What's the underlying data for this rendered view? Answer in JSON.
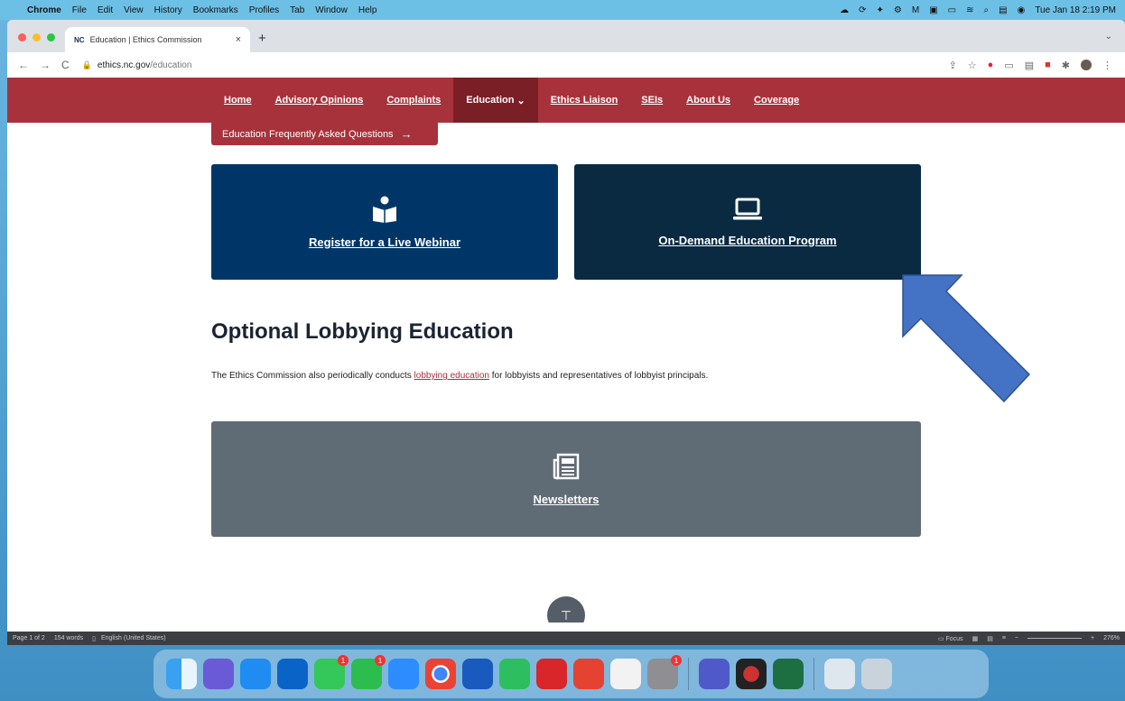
{
  "menubar": {
    "app": "Chrome",
    "items": [
      "File",
      "Edit",
      "View",
      "History",
      "Bookmarks",
      "Profiles",
      "Tab",
      "Window",
      "Help"
    ],
    "clock": "Tue Jan 18  2:19 PM"
  },
  "browser": {
    "tab_favicon": "NC",
    "tab_title": "Education | Ethics Commission",
    "url_host": "ethics.nc.gov",
    "url_path": "/education"
  },
  "site": {
    "nav": [
      "Home",
      "Advisory Opinions",
      "Complaints"
    ],
    "nav_active": "Education",
    "nav_after": [
      "Ethics Liaison",
      "SEIs",
      "About Us",
      "Coverage"
    ],
    "faq_button": "Education Frequently Asked Questions",
    "card_webinar": "Register for a Live Webinar",
    "card_ondemand": "On-Demand Education Program",
    "heading": "Optional Lobbying Education",
    "para_before": "The Ethics Commission also periodically conducts ",
    "para_link": "lobbying education",
    "para_after": " for lobbyists and representatives of lobbyist principals.",
    "card_newsletters": "Newsletters"
  },
  "word_status": {
    "page": "Page 1 of 2",
    "words": "154 words",
    "language": "English (United States)",
    "focus": "Focus",
    "zoom": "276%"
  },
  "dock": {
    "badges": [
      "1",
      "1",
      "1"
    ]
  },
  "colors": {
    "nav_red": "#a8323b",
    "card_blue": "#003667",
    "card_navy": "#0a2a42",
    "card_gray": "#5f6b75",
    "arrow_blue": "#4472c4"
  }
}
